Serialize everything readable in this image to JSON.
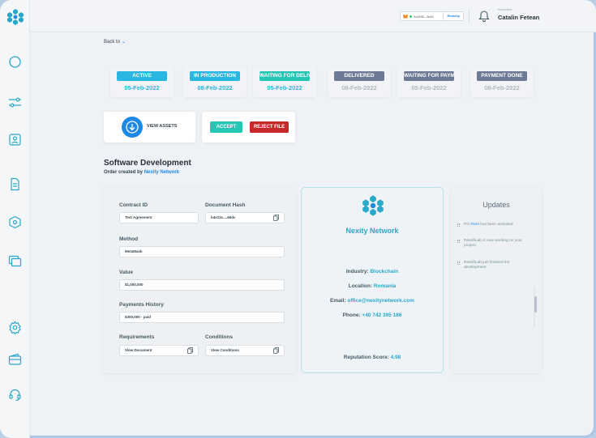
{
  "header": {
    "wallet_address": "0x2f0f2...8c51",
    "network": "Rinkeby",
    "user_role": "Executive",
    "user_name": "Catalin Fetean"
  },
  "nav": {
    "back_label": "Back to"
  },
  "statuses": [
    {
      "label": "ACTIVE",
      "date": "05-Feb-2022",
      "color": "#29b6e0",
      "date_color": "#29b6e0"
    },
    {
      "label": "IN PRODUCTION",
      "date": "08-Feb-2022",
      "color": "#29b6e0",
      "date_color": "#29b6e0"
    },
    {
      "label": "WAITING FOR DELIVERY",
      "date": "05-Feb-2022",
      "color": "#26c6b4",
      "date_color": "#29b6e0"
    },
    {
      "label": "DELIVERED",
      "date": "08-Feb-2022",
      "color": "#6c7a96",
      "date_color": "#b0b8c1"
    },
    {
      "label": "WAITING FOR PAYMENT",
      "date": "05-Feb-2022",
      "color": "#6c7a96",
      "date_color": "#b0b8c1"
    },
    {
      "label": "PAYMENT DONE",
      "date": "08-Feb-2022",
      "color": "#6c7a96",
      "date_color": "#b0b8c1"
    }
  ],
  "actions": {
    "view_assets": "VIEW ASSETS",
    "accept": "ACCEPT",
    "reject": "REJECT FILE"
  },
  "order": {
    "title": "Software Development",
    "subtitle_prefix": "Order created by",
    "subtitle_company": "Nexity Network"
  },
  "form": {
    "contract_id_label": "Contract ID",
    "contract_id_value": "Test Agreement",
    "doc_hash_label": "Document Hash",
    "doc_hash_value": "b4e13c....66dc",
    "method_label": "Method",
    "method_value": "MetaMask",
    "value_label": "Value",
    "value_value": "$1,000,000",
    "payments_label": "Payments History",
    "payments_value": "$300,000 - paid",
    "requirements_label": "Requirements",
    "requirements_value": "View Document",
    "conditions_label": "Conditions",
    "conditions_value": "View Conditions"
  },
  "company": {
    "name": "Nexity Network",
    "industry_label": "Industry:",
    "industry": "Blockchain",
    "location_label": "Location:",
    "location": "Romania",
    "email_label": "Email:",
    "email": "office@nexitynetwork.com",
    "phone_label": "Phone:",
    "phone": "+40 742 395 186",
    "reputation_label": "Reputation Score:",
    "reputation": "4.98"
  },
  "updates": {
    "title": "Updates",
    "items": [
      {
        "pre": "PO ",
        "link": "#344",
        "post": " has been activated"
      },
      {
        "pre": "ResoftLab is now working on your project.",
        "link": "",
        "post": ""
      },
      {
        "pre": "ResoftLab just finished the development.",
        "link": "",
        "post": ""
      }
    ]
  },
  "colors": {
    "accent": "#1e88e5",
    "teal": "#2aa8c9",
    "reject": "#c62828",
    "accept": "#26c6b4"
  }
}
